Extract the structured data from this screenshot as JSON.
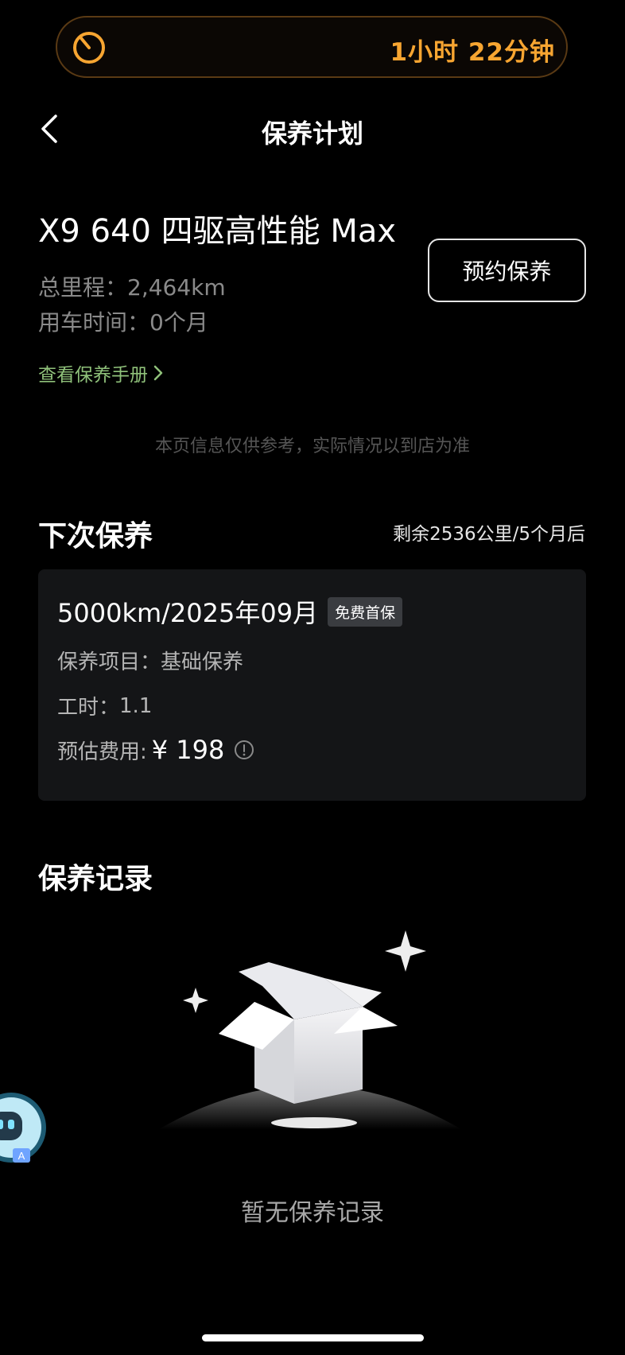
{
  "status": {
    "timer_text": "1小时 22分钟"
  },
  "nav": {
    "title": "保养计划"
  },
  "car": {
    "name": "X9 640 四驱高性能 Max",
    "mileage": "总里程：2,464km",
    "usage_time": "用车时间：0个月",
    "manual_link": "查看保养手册",
    "book_button": "预约保养"
  },
  "disclaimer": "本页信息仅供参考，实际情况以到店为准",
  "next_maintenance": {
    "title": "下次保养",
    "remaining": "剩余2536公里/5个月后",
    "interval": "5000km/2025年09月",
    "badge": "免费首保",
    "items_label": "保养项目：",
    "items_value": "基础保养",
    "hours_label": "工时：",
    "hours_value": "1.1",
    "cost_label": "预估费用:",
    "cost_value": "¥ 198"
  },
  "records": {
    "title": "保养记录",
    "empty_text": "暂无保养记录"
  },
  "colors": {
    "accent_orange": "#f7a531",
    "link_green": "#8fc17a",
    "card_bg": "#141517"
  }
}
